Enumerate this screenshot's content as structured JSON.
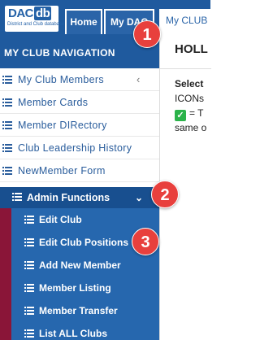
{
  "logo": {
    "text_left": "DAC",
    "text_right": "db",
    "tagline": "District and Club database"
  },
  "tabs": [
    {
      "label": "Home"
    },
    {
      "label": "My DAC"
    },
    {
      "label": "My CLUB"
    }
  ],
  "sidebar": {
    "header": "MY CLUB NAVIGATION",
    "items": [
      {
        "label": "My Club Members",
        "icon": "list-icon",
        "chevron": "‹"
      },
      {
        "label": "Member Cards",
        "icon": "list-icon"
      },
      {
        "label": "Member DIRectory",
        "icon": "list-icon"
      },
      {
        "label": "Club Leadership History",
        "icon": "list-icon"
      },
      {
        "label": "NewMember Form",
        "icon": "list-icon"
      }
    ],
    "admin": {
      "label": "Admin Functions",
      "chevron": "⌄",
      "items": [
        {
          "label": "Edit Club"
        },
        {
          "label": "Edit Club Positions"
        },
        {
          "label": "Add New Member"
        },
        {
          "label": "Member Listing"
        },
        {
          "label": "Member Transfer"
        },
        {
          "label": "List ALL Clubs"
        }
      ]
    }
  },
  "content": {
    "title": "HOLL",
    "bold_line": "Select",
    "line1": "ICONs",
    "line2": "= T",
    "line3": "same o"
  },
  "markers": [
    "1",
    "2",
    "3"
  ],
  "colors": {
    "brand_blue": "#1f5a9e",
    "admin_blue": "#2667ae",
    "accent_maroon": "#8a1538",
    "marker_red": "#e8403d",
    "check_green": "#2bb34a"
  }
}
